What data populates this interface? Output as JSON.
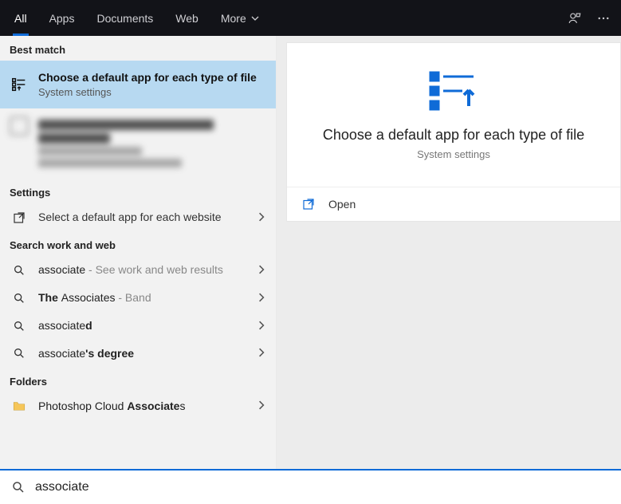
{
  "topbar": {
    "tabs": {
      "all": "All",
      "apps": "Apps",
      "documents": "Documents",
      "web": "Web",
      "more": "More"
    }
  },
  "left": {
    "best_match_label": "Best match",
    "best_match": {
      "title": "Choose a default app for each type of file",
      "sub": "System settings"
    },
    "blurred": {
      "line1": "Contract request to Sales Support",
      "line2": "Associate",
      "line3": "Outlook Item Template",
      "line4": "Last modified: 16/01/2021 · 17:56"
    },
    "settings_label": "Settings",
    "settings_row": "Select a default app for each website",
    "search_work_label": "Search work and web",
    "web1": {
      "bold": "associate",
      "gray": " - See work and web results"
    },
    "web2": {
      "pre": "The ",
      "bold": "Associate",
      "post": "s",
      "gray": " - Band"
    },
    "web3": {
      "pre": "associate",
      "bold": "d"
    },
    "web4": {
      "pre": "associate",
      "bold": "'s degree"
    },
    "folders_label": "Folders",
    "folder_row": {
      "pre": "Photoshop Cloud ",
      "bold": "Associate",
      "post": "s"
    }
  },
  "right": {
    "title": "Choose a default app for each type of file",
    "sub": "System settings",
    "open": "Open"
  },
  "search": {
    "value": "associate"
  },
  "colors": {
    "accent": "#0f6bd7",
    "selected": "#b7d9f1"
  }
}
